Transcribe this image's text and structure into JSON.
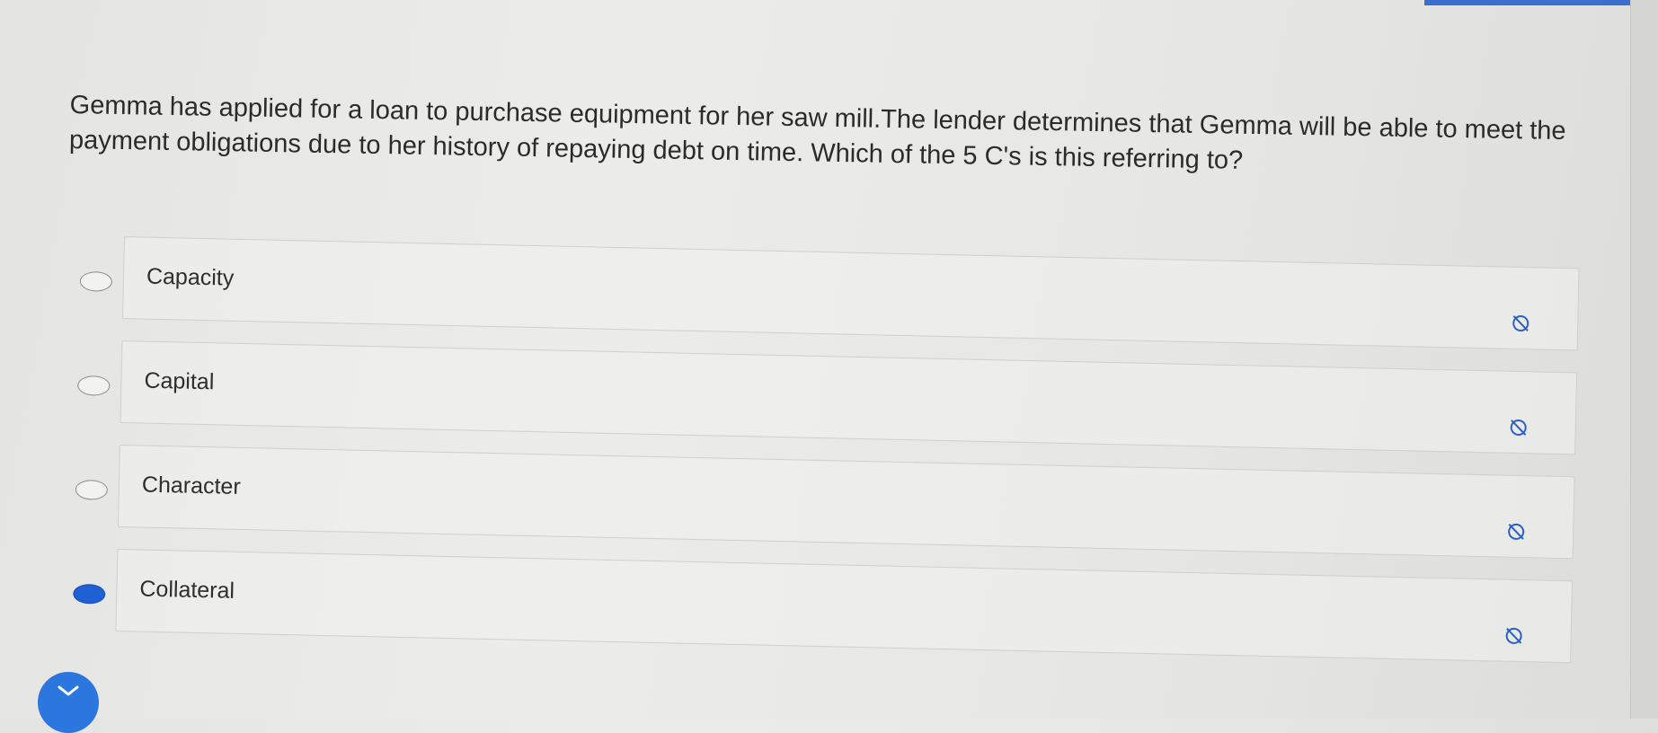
{
  "question": {
    "text": "Gemma has applied for a loan to purchase equipment for her saw mill.The lender determines that Gemma will be able to meet the payment obligations due to her history of repaying debt on time. Which of the 5 C's is this referring to?"
  },
  "options": [
    {
      "label": "Capacity",
      "selected": false
    },
    {
      "label": "Capital",
      "selected": false
    },
    {
      "label": "Character",
      "selected": false
    },
    {
      "label": "Collateral",
      "selected": true
    }
  ],
  "icons": {
    "eliminate": "eliminate-icon",
    "collapse": "chevron-down-icon"
  },
  "colors": {
    "selected_radio": "#1f5fd4",
    "accent_button": "#2c76e0"
  }
}
